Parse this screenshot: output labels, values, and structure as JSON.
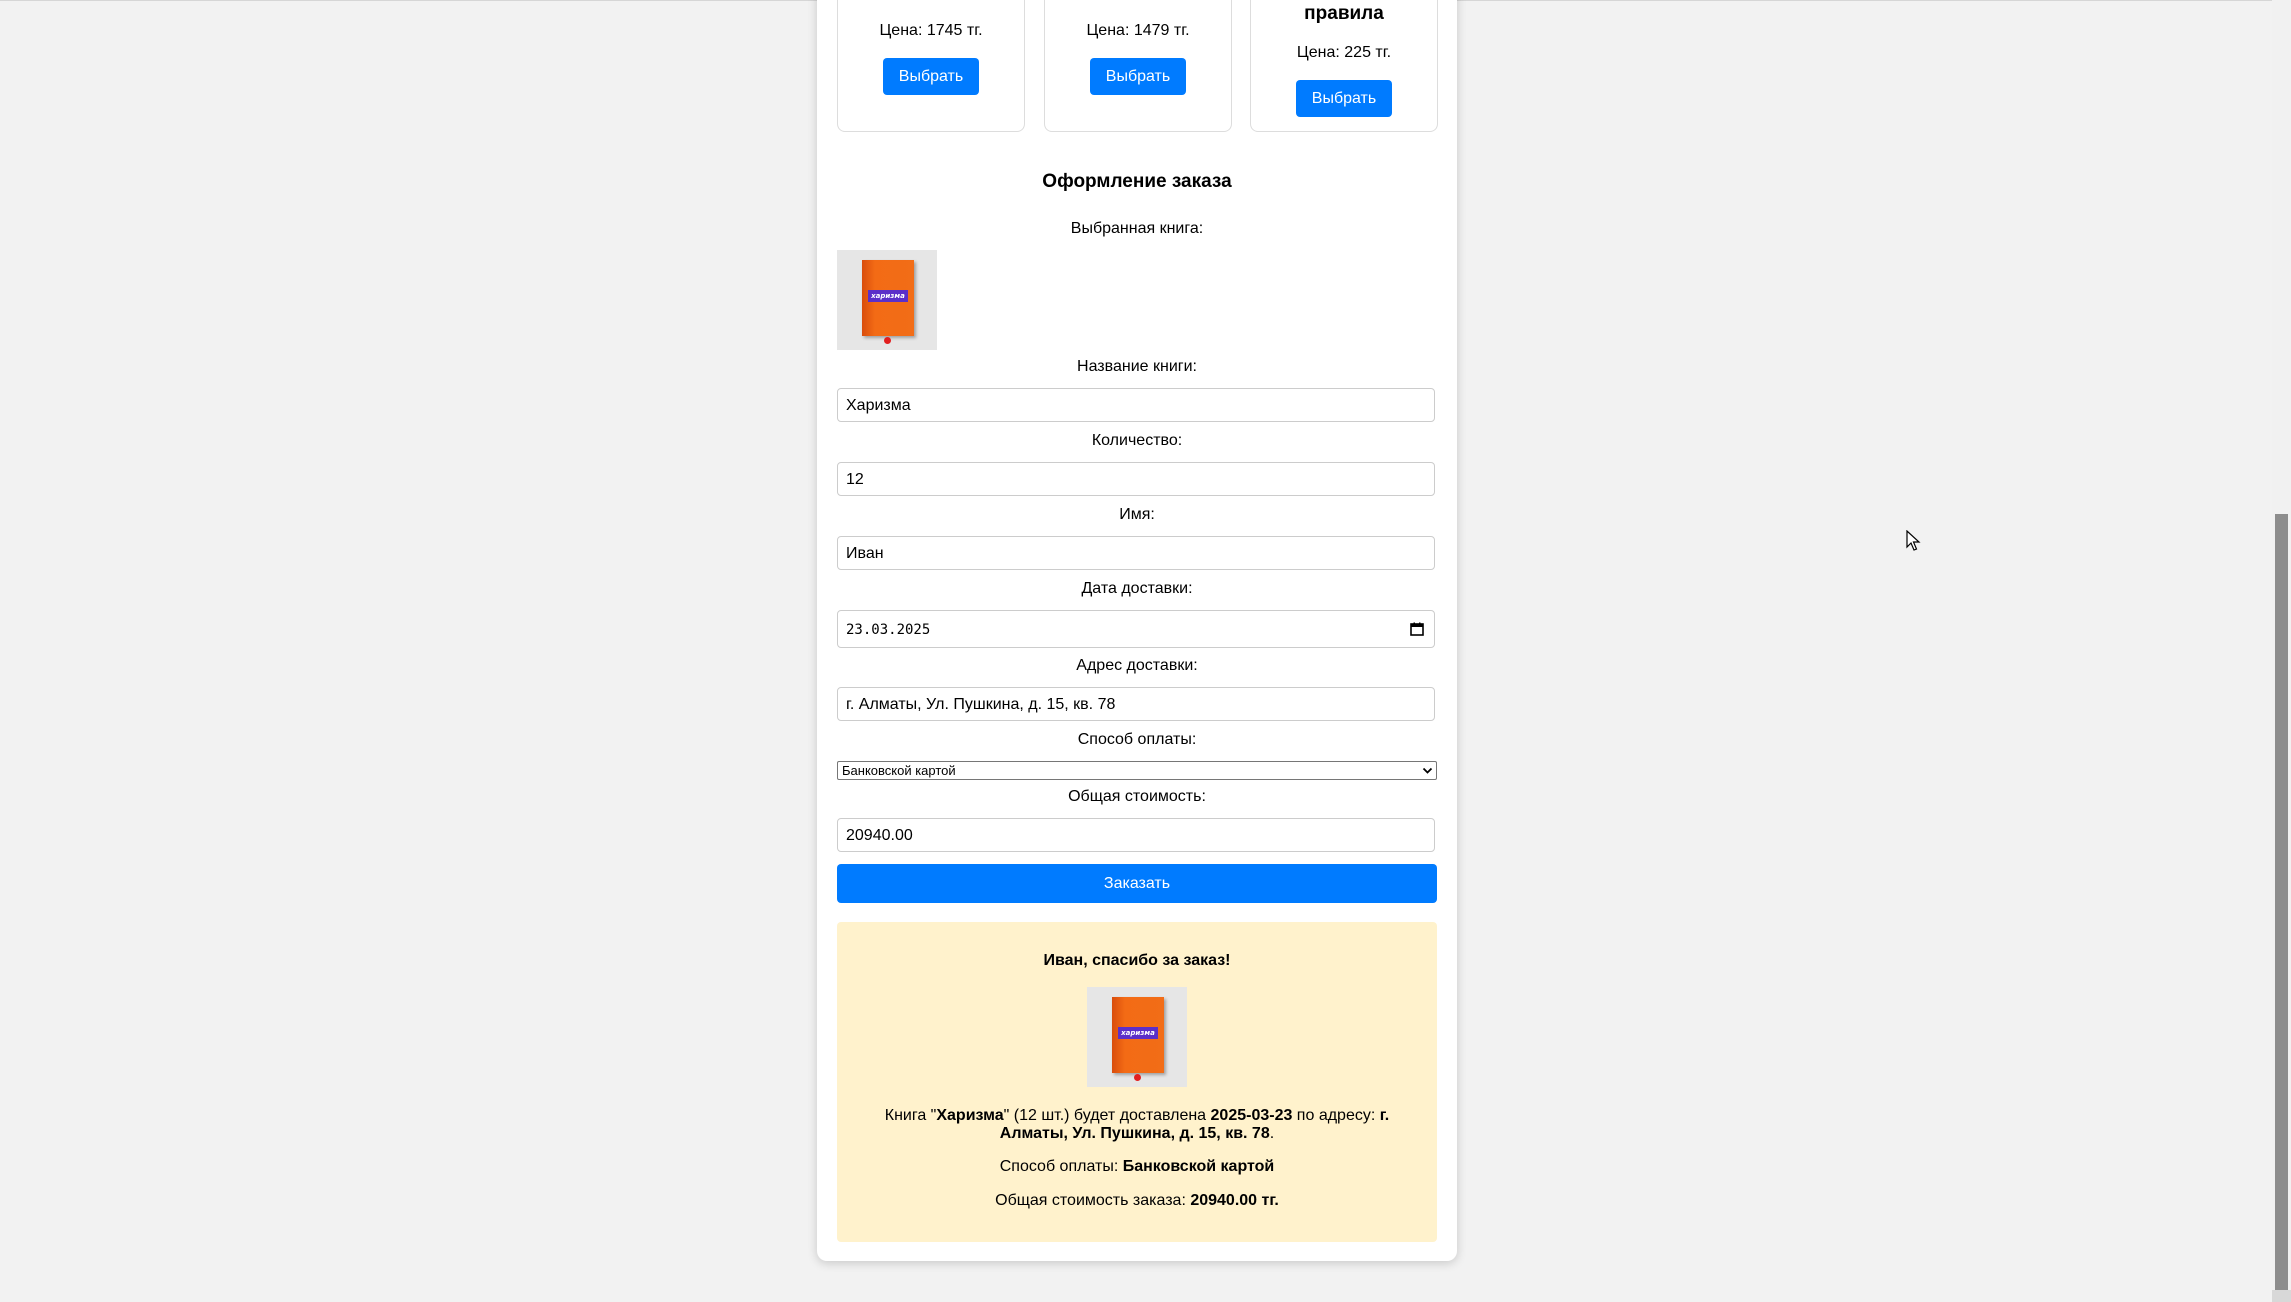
{
  "books": [
    {
      "title": "",
      "price_label": "Цена: 1745 тг.",
      "button": "Выбрать"
    },
    {
      "title": "",
      "price_label": "Цена: 1479 тг.",
      "button": "Выбрать"
    },
    {
      "title": "правила",
      "price_label": "Цена: 225 тг.",
      "button": "Выбрать"
    }
  ],
  "order": {
    "title": "Оформление заказа",
    "selected_book_label": "Выбранная книга:",
    "book_cover_text": "харизма",
    "title_label": "Название книги:",
    "title_value": "Харизма",
    "quantity_label": "Количество:",
    "quantity_value": "12",
    "name_label": "Имя:",
    "name_value": "Иван",
    "date_label": "Дата доставки:",
    "date_value": "23.03.2025",
    "address_label": "Адрес доставки:",
    "address_value": "г. Алматы, Ул. Пушкина, д. 15, кв. 78",
    "payment_label": "Способ оплаты:",
    "payment_value": "Банковской картой",
    "total_label": "Общая стоимость:",
    "total_value": "20940.00",
    "submit": "Заказать"
  },
  "confirmation": {
    "title": "Иван, спасибо за заказ!",
    "p1_a": "Книга \"",
    "p1_book": "Харизма",
    "p1_b": "\" (12 шт.) будет доставлена ",
    "p1_date": "2025-03-23",
    "p1_c": " по адресу: ",
    "p1_address": "г. Алматы, Ул. Пушкина, д. 15, кв. 78",
    "p1_d": ".",
    "p2_label": "Способ оплаты: ",
    "p2_value": "Банковской картой",
    "p3_label": "Общая стоимость заказа: ",
    "p3_value": "20940.00 тг."
  },
  "icons": [
    "calendar-icon",
    "chevron-down-icon",
    "mouse-cursor-icon"
  ],
  "colors": {
    "primary": "#007bff",
    "confirm_bg": "#fff2cc",
    "page_bg": "#f2f2f2"
  }
}
